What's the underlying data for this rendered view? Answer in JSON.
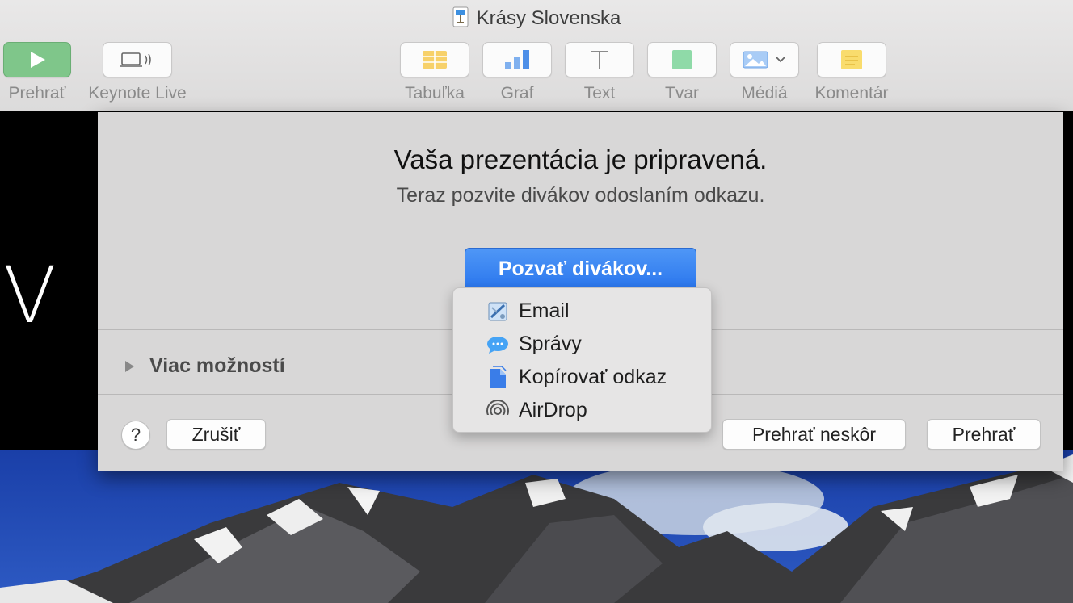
{
  "window": {
    "title": "Krásy Slovenska"
  },
  "toolbar": {
    "play_label": "Prehrať",
    "keynote_live_label": "Keynote Live",
    "table_label": "Tabuľka",
    "chart_label": "Graf",
    "text_label": "Text",
    "shape_label": "Tvar",
    "media_label": "Médiá",
    "comment_label": "Komentár"
  },
  "slide": {
    "letter": "V"
  },
  "sheet": {
    "title": "Vaša prezentácia je pripravená.",
    "subtitle": "Teraz pozvite divákov odoslaním odkazu.",
    "invite_button": "Pozvať divákov...",
    "more_options": "Viac možností",
    "help": "?",
    "cancel_button": "Zrušiť",
    "play_later_button": "Prehrať neskôr",
    "play_button": "Prehrať"
  },
  "share_menu": {
    "items": [
      {
        "label": "Email",
        "icon": "mail-icon"
      },
      {
        "label": "Správy",
        "icon": "messages-icon"
      },
      {
        "label": "Kopírovať odkaz",
        "icon": "copy-link-icon"
      },
      {
        "label": "AirDrop",
        "icon": "airdrop-icon"
      }
    ]
  },
  "colors": {
    "accent": "#2a76ee",
    "play_green": "#7fc68a"
  }
}
